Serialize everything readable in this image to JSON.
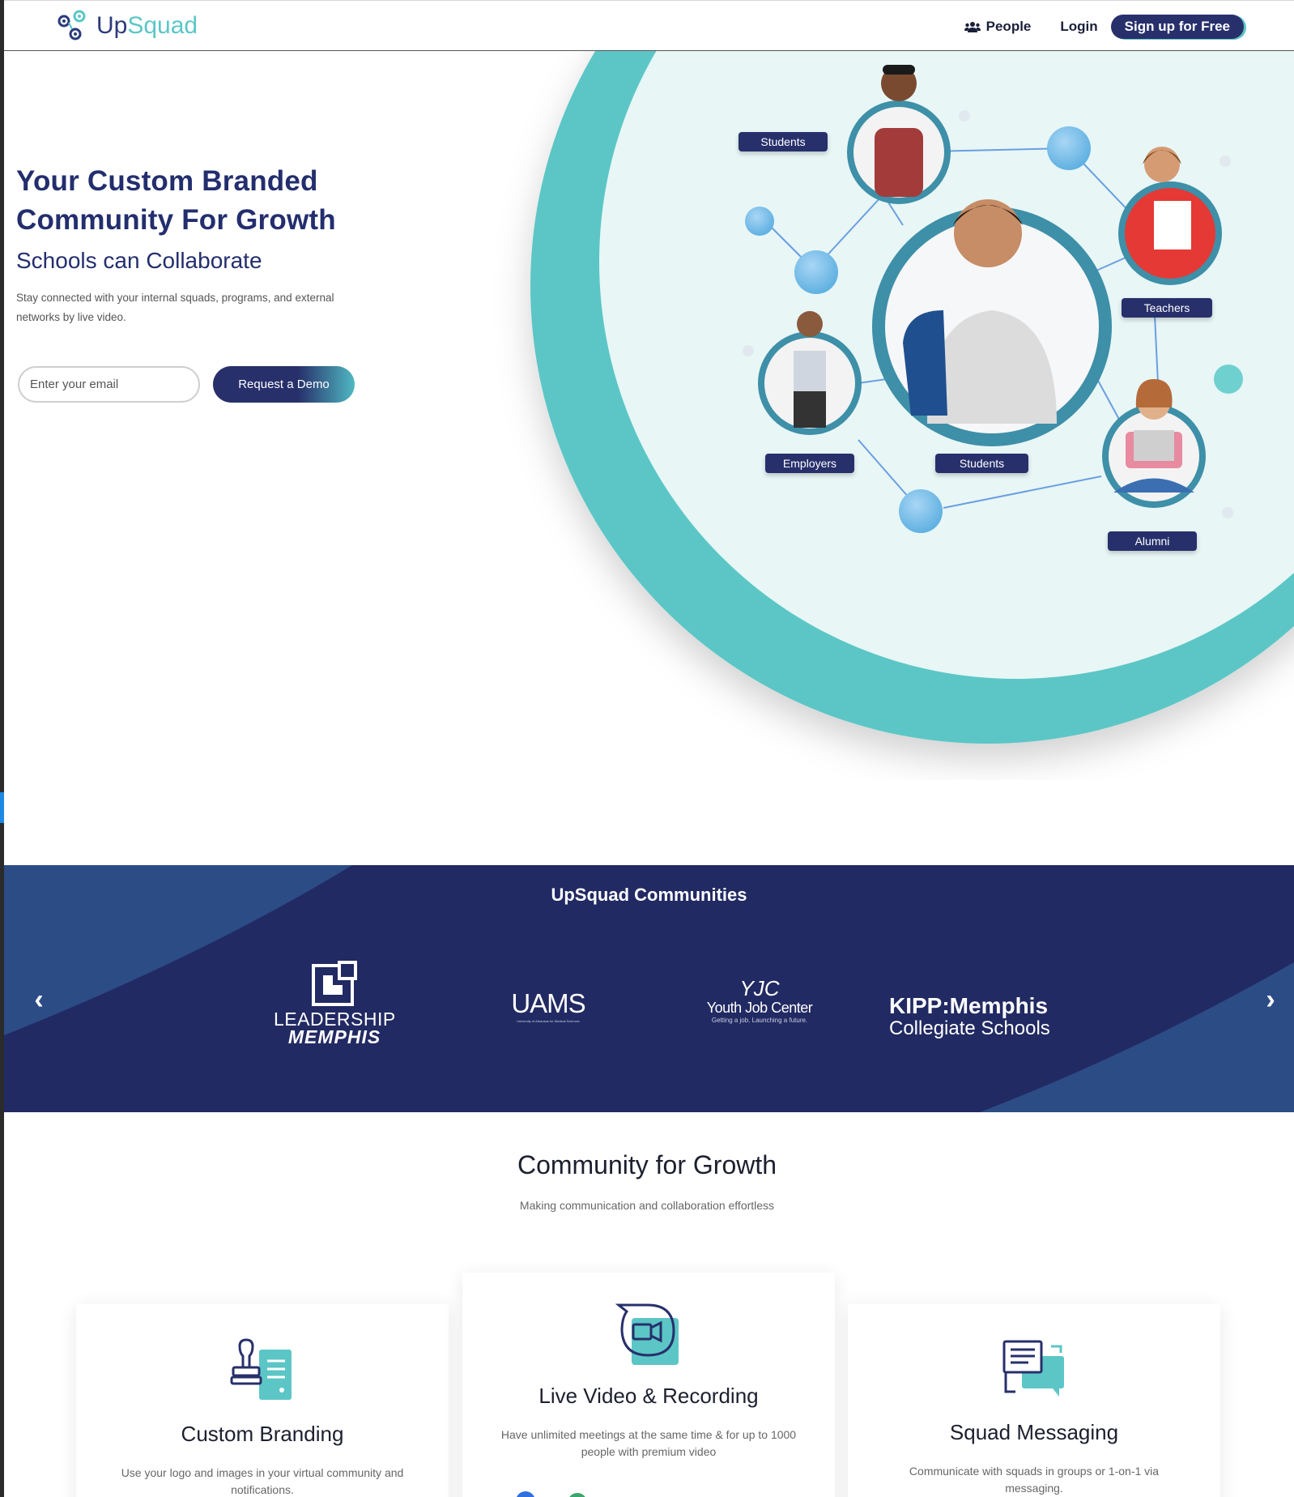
{
  "brand": {
    "name_prefix": "Up",
    "name_suffix": "Squad",
    "accent": "#5cc6c6",
    "navy": "#232e6e"
  },
  "nav": {
    "people_label": "People",
    "login_label": "Login",
    "signup_label": "Sign up for Free"
  },
  "hero": {
    "title_line1": "Your Custom Branded",
    "title_line2": "Community For Growth",
    "subtitle": "Schools can Collaborate",
    "description": "Stay connected with your internal squads, programs, and external networks by live video.",
    "email_placeholder": "Enter your email",
    "demo_button": "Request a Demo",
    "network_labels": {
      "students_top": "Students",
      "teachers": "Teachers",
      "employers": "Employers",
      "students_center": "Students",
      "alumni": "Alumni"
    }
  },
  "communities": {
    "title": "UpSquad Communities",
    "logos": {
      "leadership_line1": "LEADERSHIP",
      "leadership_line2": "MEMPHIS",
      "uams": "UAMS",
      "uams_small": "University of Arkansas for Medical Sciences",
      "yjc_mark": "YJC",
      "yjc_name": "Youth Job Center",
      "yjc_tagline": "Getting a job. Launching a future.",
      "kipp_line1": "KIPP:Memphis",
      "kipp_line2": "Collegiate Schools"
    }
  },
  "growth": {
    "title": "Community for Growth",
    "subtitle": "Making communication and collaboration effortless",
    "cards": [
      {
        "title": "Custom Branding",
        "desc": "Use your logo and images in your virtual community and notifications."
      },
      {
        "title": "Live Video & Recording",
        "desc": "Have unlimited meetings at the same time & for up to 1000 people with premium video"
      },
      {
        "title": "Squad Messaging",
        "desc": "Communicate with squads in groups or 1-on-1 via messaging."
      }
    ]
  }
}
